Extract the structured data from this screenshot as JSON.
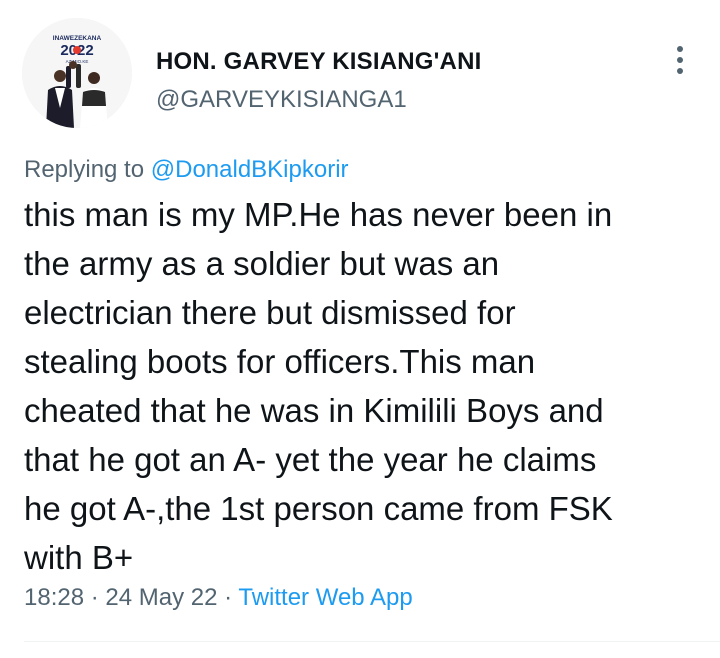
{
  "author": {
    "display_name": "HON. GARVEY KISIANG'ANI",
    "handle": "@GARVEYKISIANGA1",
    "avatar_text_top": "INAWEZEKANA",
    "avatar_text_year": "2022",
    "avatar_text_sub": "AZIMIO.KE"
  },
  "reply": {
    "prefix": "Replying to ",
    "to_handle": "@DonaldBKipkorir"
  },
  "tweet": {
    "text": "this man is my MP.He has never been in\nthe army as a soldier but was an\nelectrician there but dismissed for\nstealing boots for officers.This man\ncheated that he was in Kimilili Boys and\nthat he got an A- yet the year he claims\nhe got A-,the 1st person came from FSK\nwith B+"
  },
  "meta": {
    "time": "18:28",
    "separator1": " · ",
    "date": "24 May 22",
    "separator2": " · ",
    "source": "Twitter Web App"
  },
  "icons": {
    "more": "more-vertical-icon"
  },
  "colors": {
    "text": "#0f1419",
    "secondary": "#536471",
    "link": "#1d9bf0",
    "divider": "#eff3f4"
  }
}
